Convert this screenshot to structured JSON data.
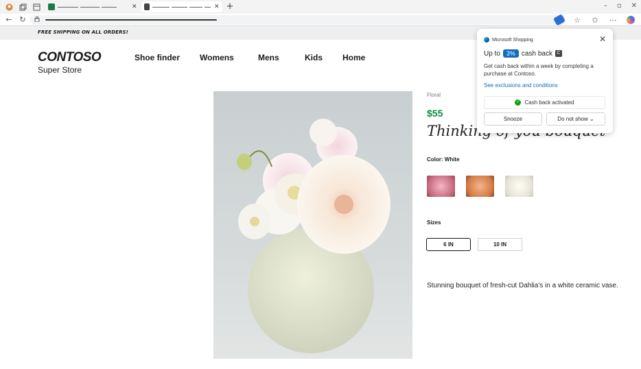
{
  "browser": {
    "win_minimize": "–",
    "win_restore": "▫",
    "win_close": "✕"
  },
  "site": {
    "promo_text": "FREE SHIPPING ON ALL ORDERS!",
    "logo_main": "CONTOSO",
    "logo_sub": "Super Store",
    "nav": [
      "Shoe finder",
      "Womens",
      "Mens",
      "Kids",
      "Home"
    ]
  },
  "product": {
    "category": "Floral",
    "price": "$55",
    "title": "Thinking of you bouquet",
    "color_label": "Color: White",
    "swatches": [
      {
        "name": "pink",
        "color": "#d98a9c"
      },
      {
        "name": "peach",
        "color": "#d98c5c"
      },
      {
        "name": "white",
        "color": "#ece9e2"
      }
    ],
    "sizes_label": "Sizes",
    "sizes": [
      "6 IN",
      "10 IN"
    ],
    "selected_size": "6 IN",
    "description": "Stunning bouquet of fresh-cut Dahlia's in a white ceramic vase."
  },
  "shopping_popup": {
    "header": "Microsoft Shopping",
    "up_to": "Up to",
    "percent": "3%",
    "cash_back": "cash back",
    "subtext": "Get cash back within a week by completing a purchase at Contoso.",
    "link": "See exclusions and conditions",
    "status": "Cash back activated",
    "snooze": "Snooze",
    "do_not_show": "Do not show ⌄"
  },
  "colors": {
    "price_green": "#0e8a3e",
    "accent_blue": "#0f6cbd",
    "promo_bg": "#efefef"
  }
}
